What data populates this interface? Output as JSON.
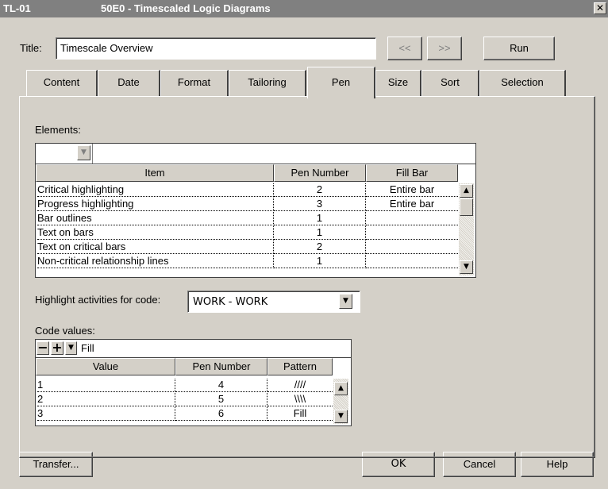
{
  "window": {
    "id": "TL-01",
    "title": "50E0 - Timescaled Logic Diagrams",
    "close_glyph": "✕"
  },
  "title_field": {
    "label": "Title:",
    "value": "Timescale Overview"
  },
  "toolbar": {
    "prev_label": "<<",
    "next_label": ">>",
    "run_label": "Run"
  },
  "tabs": [
    {
      "label": "Content",
      "active": false
    },
    {
      "label": "Date",
      "active": false
    },
    {
      "label": "Format",
      "active": false
    },
    {
      "label": "Tailoring",
      "active": false
    },
    {
      "label": "Pen",
      "active": true
    },
    {
      "label": "Size",
      "active": false
    },
    {
      "label": "Sort",
      "active": false
    },
    {
      "label": "Selection",
      "active": false
    }
  ],
  "elements": {
    "label": "Elements:",
    "columns": [
      "Item",
      "Pen Number",
      "Fill Bar"
    ],
    "rows": [
      {
        "item": "Critical highlighting",
        "pen": "2",
        "fill": "Entire bar"
      },
      {
        "item": "Progress highlighting",
        "pen": "3",
        "fill": "Entire bar"
      },
      {
        "item": "Bar outlines",
        "pen": "1",
        "fill": ""
      },
      {
        "item": "Text on bars",
        "pen": "1",
        "fill": ""
      },
      {
        "item": "Text on critical bars",
        "pen": "2",
        "fill": ""
      },
      {
        "item": "Non-critical relationship lines",
        "pen": "1",
        "fill": ""
      }
    ]
  },
  "highlight": {
    "label": "Highlight activities for code:",
    "value": "WORK - WORK"
  },
  "code_values": {
    "label": "Code values:",
    "minus_glyph": "−",
    "plus_glyph": "+",
    "edit_value": "Fill",
    "columns": [
      "Value",
      "Pen Number",
      "Pattern"
    ],
    "rows": [
      {
        "value": "1",
        "pen": "4",
        "pattern": "////"
      },
      {
        "value": "2",
        "pen": "5",
        "pattern": "\\\\\\\\"
      },
      {
        "value": "3",
        "pen": "6",
        "pattern": "Fill"
      }
    ]
  },
  "footer": {
    "transfer_label": "Transfer...",
    "ok_label": "OK",
    "cancel_label": "Cancel",
    "help_label": "Help"
  },
  "icons": {
    "up_arrow": "▲",
    "down_arrow": "▼"
  }
}
